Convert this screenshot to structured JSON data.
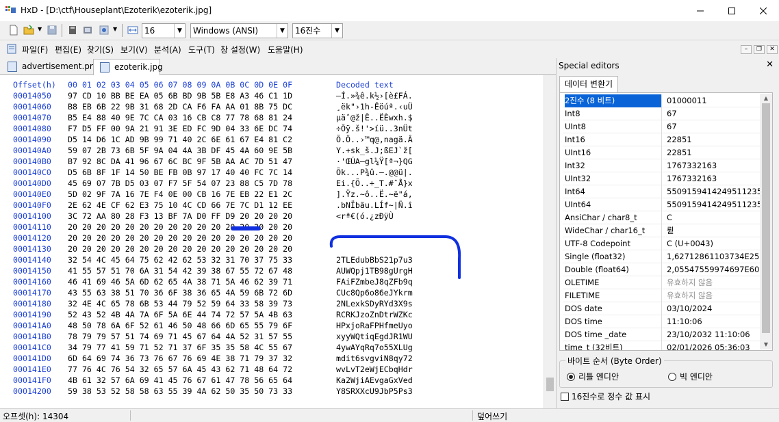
{
  "window": {
    "title": "HxD - [D:\\ctf\\Houseplant\\Ezoterik\\ezoterik.jpg]"
  },
  "toolbar": {
    "bytes_per_row": "16",
    "charset": "Windows (ANSI)",
    "offset_base": "16진수"
  },
  "menu": {
    "items": [
      "파일(F)",
      "편집(E)",
      "찾기(S)",
      "보기(V)",
      "분석(A)",
      "도구(T)",
      "창 설정(W)",
      "도움말(H)"
    ]
  },
  "tabs": [
    {
      "label": "advertisement.png",
      "active": false
    },
    {
      "label": "ezoterik.jpg",
      "active": true
    }
  ],
  "hex": {
    "header": {
      "offset": "Offset(h)",
      "columns": "00 01 02 03 04 05 06 07 08 09 0A 0B 0C 0D 0E 0F",
      "decoded": "Decoded text"
    },
    "rows": [
      {
        "offset": "00014050",
        "hex": "97 CD 10 BB BE EA 05 6B BD 9B 5B E8 A3 46 C1 1D",
        "text": "—Í.»¾ê.k½›[è£FÁ."
      },
      {
        "offset": "00014060",
        "hex": "B8 EB 6B 22 9B 31 68 2D CA F6 FA AA 01 8B 75 DC",
        "text": "¸ëk\"›1h-Êöúª.‹uÜ"
      },
      {
        "offset": "00014070",
        "hex": "B5 E4 88 40 9E 7C CA 03 16 CB C8 77 78 68 81 24",
        "text": "µäˆ@ž|Ê..ËÈwxh.$"
      },
      {
        "offset": "00014080",
        "hex": "F7 D5 FF 00 9A 21 91 3E ED FC 9D 04 33 6E DC 74",
        "text": "÷Õÿ.š!'>íü..3nÜt"
      },
      {
        "offset": "00014090",
        "hex": "D5 14 D6 1C AD 9B 99 71 40 2C 6E 61 67 E4 81 C2",
        "text": "Õ.Ö..›™q@,nagä.Â"
      },
      {
        "offset": "000140A0",
        "hex": "59 07 2B 73 6B 5F 9A 04 4A 3B DF 45 4A 60 9E 5B",
        "text": "Y.+sk_š.J;ßEJ`ž["
      },
      {
        "offset": "000140B0",
        "hex": "B7 92 8C DA 41 96 67 6C BC 9F 5B AA AC 7D 51 47",
        "text": "·'ŒÚA–gl¼Ÿ[ª¬}QG"
      },
      {
        "offset": "000140C0",
        "hex": "D5 6B 8F 1F 14 50 BE FB 0B 97 17 40 40 FC 7C 14",
        "text": "Õk...P¾û.—.@@ü|."
      },
      {
        "offset": "000140D0",
        "hex": "45 69 07 7B D5 03 07 F7 5F 54 07 23 88 C5 7D 78",
        "text": "Ei.{Õ..÷_T.#ˆÅ}x"
      },
      {
        "offset": "000140E0",
        "hex": "5D 02 9F 7A 16 7E F4 0E 00 CB 16 7E EB 22 E1 2C",
        "text": "].Ÿz.~ô..Ë.~ë\"á,"
      },
      {
        "offset": "000140F0",
        "hex": "2E 62 4E CF 62 E3 75 10 4C CD 66 7E 7C D1 12 EE",
        "text": ".bNÏbãu.LÍf~|Ñ.î"
      },
      {
        "offset": "00014100",
        "hex": "3C 72 AA 80 28 F3 13 BF 7A D0 FF D9 20 20 20 20",
        "text": "<rª€(ó.¿zÐÿÙ    "
      },
      {
        "offset": "00014110",
        "hex": "20 20 20 20 20 20 20 20 20 20 20 20 20 20 20 20",
        "text": ""
      },
      {
        "offset": "00014120",
        "hex": "20 20 20 20 20 20 20 20 20 20 20 20 20 20 20 20",
        "text": ""
      },
      {
        "offset": "00014130",
        "hex": "20 20 20 20 20 20 20 20 20 20 20 20 20 20 20 20",
        "text": ""
      },
      {
        "offset": "00014140",
        "hex": "32 54 4C 45 64 75 62 42 62 53 32 31 70 37 75 33",
        "text": "2TLEdubBbS21p7u3"
      },
      {
        "offset": "00014150",
        "hex": "41 55 57 51 70 6A 31 54 42 39 38 67 55 72 67 48",
        "text": "AUWQpj1TB98gUrgH"
      },
      {
        "offset": "00014160",
        "hex": "46 41 69 46 5A 6D 62 65 4A 38 71 5A 46 62 39 71",
        "text": "FAiFZmbeJ8qZFb9q"
      },
      {
        "offset": "00014170",
        "hex": "43 55 63 38 51 70 36 6F 38 36 65 4A 59 6B 72 6D",
        "text": "CUc8Qp6o86eJYkrm"
      },
      {
        "offset": "00014180",
        "hex": "32 4E 4C 65 78 6B 53 44 79 52 59 64 33 58 39 73",
        "text": "2NLexkSDyRYd3X9s"
      },
      {
        "offset": "00014190",
        "hex": "52 43 52 4B 4A 7A 6F 5A 6E 44 74 72 57 5A 4B 63",
        "text": "RCRKJzoZnDtrWZKc"
      },
      {
        "offset": "000141A0",
        "hex": "48 50 78 6A 6F 52 61 46 50 48 66 6D 65 55 79 6F",
        "text": "HPxjoRaFPHfmeUyo"
      },
      {
        "offset": "000141B0",
        "hex": "78 79 79 57 51 74 69 71 45 67 64 4A 52 31 57 55",
        "text": "xyyWQtiqEgdJR1WU"
      },
      {
        "offset": "000141C0",
        "hex": "34 79 77 41 59 71 52 71 37 6F 35 35 58 4C 55 67",
        "text": "4ywAYqRq7o55XLUg"
      },
      {
        "offset": "000141D0",
        "hex": "6D 64 69 74 36 73 76 67 76 69 4E 38 71 79 37 32",
        "text": "mdit6svgviN8qy72"
      },
      {
        "offset": "000141E0",
        "hex": "77 76 4C 76 54 32 65 57 6A 45 43 62 71 48 64 72",
        "text": "wvLvT2eWjECbqHdr"
      },
      {
        "offset": "000141F0",
        "hex": "4B 61 32 57 6A 69 41 45 76 67 61 47 78 56 65 64",
        "text": "Ka2WjiAEvgaGxVed"
      },
      {
        "offset": "00014200",
        "hex": "59 38 53 52 58 58 63 55 39 4A 62 50 35 50 73 33",
        "text": "Y8SRXXcU9JbP5Ps3"
      }
    ]
  },
  "data_inspector": {
    "title": "Special editors",
    "tab_label": "데이터 변환기",
    "rows": [
      {
        "label": "2진수 (8 비트)",
        "value": "01000011",
        "selected": true
      },
      {
        "label": "Int8",
        "value": "67"
      },
      {
        "label": "UInt8",
        "value": "67"
      },
      {
        "label": "Int16",
        "value": "22851"
      },
      {
        "label": "UInt16",
        "value": "22851"
      },
      {
        "label": "Int32",
        "value": "1767332163"
      },
      {
        "label": "UInt32",
        "value": "1767332163"
      },
      {
        "label": "Int64",
        "value": "5509159414249511235"
      },
      {
        "label": "UInt64",
        "value": "5509159414249511235"
      },
      {
        "label": "AnsiChar / char8_t",
        "value": "C"
      },
      {
        "label": "WideChar / char16_t",
        "value": "륃"
      },
      {
        "label": "UTF-8 Codepoint",
        "value": "C (U+0043)"
      },
      {
        "label": "Single (float32)",
        "value": "1,62712861103734E25"
      },
      {
        "label": "Double (float64)",
        "value": "2,05547559974697E60"
      },
      {
        "label": "OLETIME",
        "value": "유효하지 않음",
        "gray": true
      },
      {
        "label": "FILETIME",
        "value": "유효하지 않음",
        "gray": true
      },
      {
        "label": "DOS date",
        "value": "03/10/2024"
      },
      {
        "label": "DOS time",
        "value": "11:10:06"
      },
      {
        "label": "DOS time _date",
        "value": "23/10/2032 11:10:06"
      },
      {
        "label": "time_t (32비트)",
        "value": "02/01/2026 05:36:03"
      }
    ],
    "byte_order": {
      "legend": "바이트 순서 (Byte Order)",
      "little": "리틀 엔디안",
      "big": "빅 엔디안",
      "selected": "little"
    },
    "hex_checkbox_label": "16진수로 정수 값 표시"
  },
  "status": {
    "offset": "오프셋(h): 14304",
    "mode": "덮어쓰기"
  },
  "colors": {
    "offset_blue": "#1a3fd6",
    "annotation_blue": "#1030e0",
    "selection": "#0a64d8"
  }
}
